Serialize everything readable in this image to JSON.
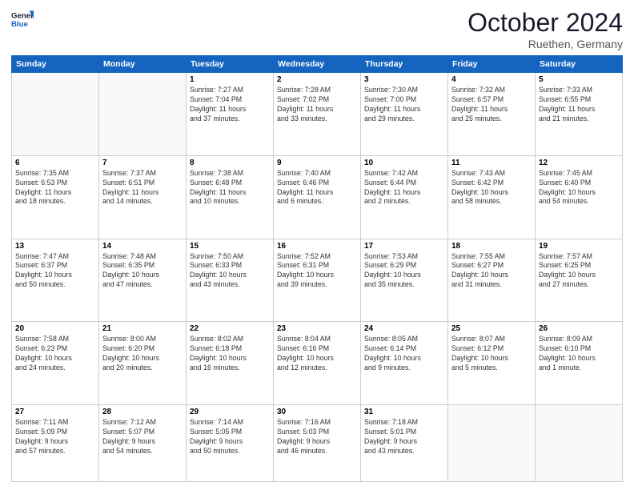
{
  "logo": {
    "line1": "General",
    "line2": "Blue"
  },
  "title": {
    "month_year": "October 2024",
    "location": "Ruethen, Germany"
  },
  "weekdays": [
    "Sunday",
    "Monday",
    "Tuesday",
    "Wednesday",
    "Thursday",
    "Friday",
    "Saturday"
  ],
  "weeks": [
    [
      {
        "day": "",
        "info": ""
      },
      {
        "day": "",
        "info": ""
      },
      {
        "day": "1",
        "info": "Sunrise: 7:27 AM\nSunset: 7:04 PM\nDaylight: 11 hours\nand 37 minutes."
      },
      {
        "day": "2",
        "info": "Sunrise: 7:28 AM\nSunset: 7:02 PM\nDaylight: 11 hours\nand 33 minutes."
      },
      {
        "day": "3",
        "info": "Sunrise: 7:30 AM\nSunset: 7:00 PM\nDaylight: 11 hours\nand 29 minutes."
      },
      {
        "day": "4",
        "info": "Sunrise: 7:32 AM\nSunset: 6:57 PM\nDaylight: 11 hours\nand 25 minutes."
      },
      {
        "day": "5",
        "info": "Sunrise: 7:33 AM\nSunset: 6:55 PM\nDaylight: 11 hours\nand 21 minutes."
      }
    ],
    [
      {
        "day": "6",
        "info": "Sunrise: 7:35 AM\nSunset: 6:53 PM\nDaylight: 11 hours\nand 18 minutes."
      },
      {
        "day": "7",
        "info": "Sunrise: 7:37 AM\nSunset: 6:51 PM\nDaylight: 11 hours\nand 14 minutes."
      },
      {
        "day": "8",
        "info": "Sunrise: 7:38 AM\nSunset: 6:48 PM\nDaylight: 11 hours\nand 10 minutes."
      },
      {
        "day": "9",
        "info": "Sunrise: 7:40 AM\nSunset: 6:46 PM\nDaylight: 11 hours\nand 6 minutes."
      },
      {
        "day": "10",
        "info": "Sunrise: 7:42 AM\nSunset: 6:44 PM\nDaylight: 11 hours\nand 2 minutes."
      },
      {
        "day": "11",
        "info": "Sunrise: 7:43 AM\nSunset: 6:42 PM\nDaylight: 10 hours\nand 58 minutes."
      },
      {
        "day": "12",
        "info": "Sunrise: 7:45 AM\nSunset: 6:40 PM\nDaylight: 10 hours\nand 54 minutes."
      }
    ],
    [
      {
        "day": "13",
        "info": "Sunrise: 7:47 AM\nSunset: 6:37 PM\nDaylight: 10 hours\nand 50 minutes."
      },
      {
        "day": "14",
        "info": "Sunrise: 7:48 AM\nSunset: 6:35 PM\nDaylight: 10 hours\nand 47 minutes."
      },
      {
        "day": "15",
        "info": "Sunrise: 7:50 AM\nSunset: 6:33 PM\nDaylight: 10 hours\nand 43 minutes."
      },
      {
        "day": "16",
        "info": "Sunrise: 7:52 AM\nSunset: 6:31 PM\nDaylight: 10 hours\nand 39 minutes."
      },
      {
        "day": "17",
        "info": "Sunrise: 7:53 AM\nSunset: 6:29 PM\nDaylight: 10 hours\nand 35 minutes."
      },
      {
        "day": "18",
        "info": "Sunrise: 7:55 AM\nSunset: 6:27 PM\nDaylight: 10 hours\nand 31 minutes."
      },
      {
        "day": "19",
        "info": "Sunrise: 7:57 AM\nSunset: 6:25 PM\nDaylight: 10 hours\nand 27 minutes."
      }
    ],
    [
      {
        "day": "20",
        "info": "Sunrise: 7:58 AM\nSunset: 6:23 PM\nDaylight: 10 hours\nand 24 minutes."
      },
      {
        "day": "21",
        "info": "Sunrise: 8:00 AM\nSunset: 6:20 PM\nDaylight: 10 hours\nand 20 minutes."
      },
      {
        "day": "22",
        "info": "Sunrise: 8:02 AM\nSunset: 6:18 PM\nDaylight: 10 hours\nand 16 minutes."
      },
      {
        "day": "23",
        "info": "Sunrise: 8:04 AM\nSunset: 6:16 PM\nDaylight: 10 hours\nand 12 minutes."
      },
      {
        "day": "24",
        "info": "Sunrise: 8:05 AM\nSunset: 6:14 PM\nDaylight: 10 hours\nand 9 minutes."
      },
      {
        "day": "25",
        "info": "Sunrise: 8:07 AM\nSunset: 6:12 PM\nDaylight: 10 hours\nand 5 minutes."
      },
      {
        "day": "26",
        "info": "Sunrise: 8:09 AM\nSunset: 6:10 PM\nDaylight: 10 hours\nand 1 minute."
      }
    ],
    [
      {
        "day": "27",
        "info": "Sunrise: 7:11 AM\nSunset: 5:09 PM\nDaylight: 9 hours\nand 57 minutes."
      },
      {
        "day": "28",
        "info": "Sunrise: 7:12 AM\nSunset: 5:07 PM\nDaylight: 9 hours\nand 54 minutes."
      },
      {
        "day": "29",
        "info": "Sunrise: 7:14 AM\nSunset: 5:05 PM\nDaylight: 9 hours\nand 50 minutes."
      },
      {
        "day": "30",
        "info": "Sunrise: 7:16 AM\nSunset: 5:03 PM\nDaylight: 9 hours\nand 46 minutes."
      },
      {
        "day": "31",
        "info": "Sunrise: 7:18 AM\nSunset: 5:01 PM\nDaylight: 9 hours\nand 43 minutes."
      },
      {
        "day": "",
        "info": ""
      },
      {
        "day": "",
        "info": ""
      }
    ]
  ]
}
